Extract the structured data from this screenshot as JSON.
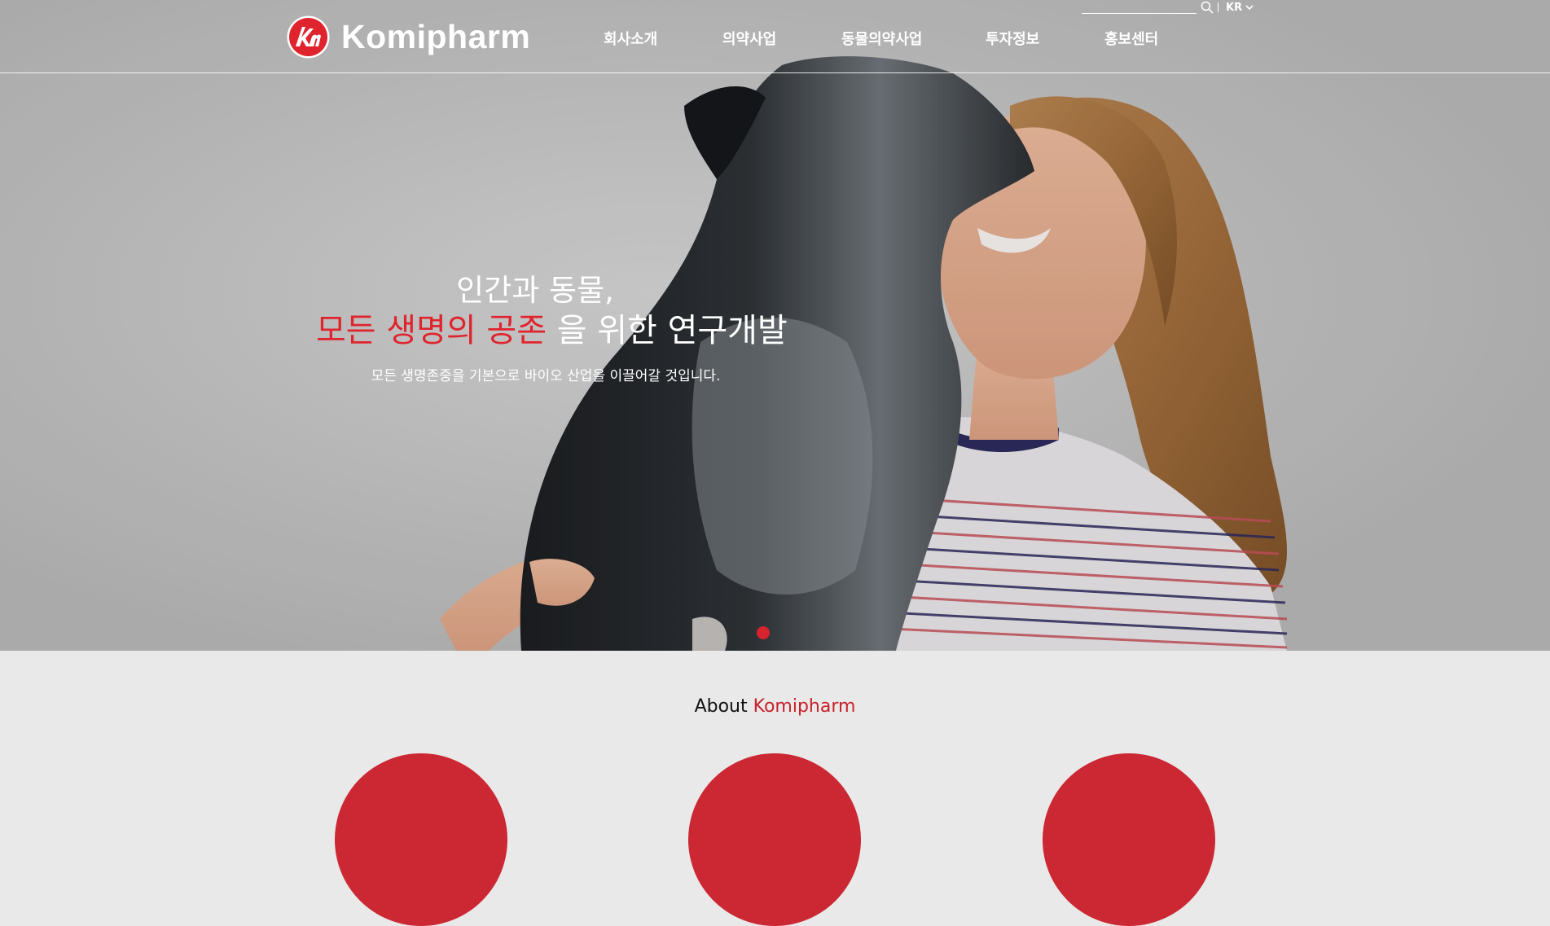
{
  "brand": {
    "name": "Komipharm",
    "accent_color": "#e0242e",
    "logo_icon": "km-circle-logo"
  },
  "nav": {
    "items": [
      {
        "label": "회사소개"
      },
      {
        "label": "의약사업"
      },
      {
        "label": "동물의약사업"
      },
      {
        "label": "투자정보"
      },
      {
        "label": "홍보센터"
      }
    ]
  },
  "utility": {
    "search_placeholder": "",
    "search_icon": "search-icon",
    "language": "KR",
    "language_icon": "chevron-down-icon"
  },
  "hero": {
    "title_line1": "인간과 동물,",
    "title_accent": "모든 생명의 공존",
    "title_rest": " 을 위한 연구개발",
    "subtitle": "모든 생명존중을 기본으로 바이오 산업을 이끌어갈 것입니다.",
    "slide_count": 1,
    "active_slide": 1
  },
  "about": {
    "prefix": "About ",
    "brand": "Komipharm"
  }
}
